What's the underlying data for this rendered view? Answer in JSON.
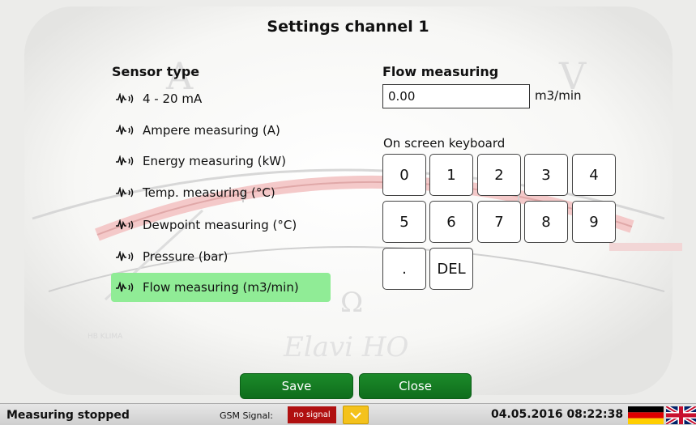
{
  "window": {
    "title": "Settings channel 1"
  },
  "sensor_panel": {
    "heading": "Sensor type",
    "items": [
      {
        "label": "4 - 20 mA",
        "selected": false
      },
      {
        "label": "Ampere measuring (A)",
        "selected": false
      },
      {
        "label": "Energy measuring (kW)",
        "selected": false
      },
      {
        "label": "Temp. measuring (°C)",
        "selected": false
      },
      {
        "label": "Dewpoint measuring (°C)",
        "selected": false
      },
      {
        "label": "Pressure (bar)",
        "selected": false
      },
      {
        "label": "Flow measuring (m3/min)",
        "selected": true
      }
    ],
    "item_icon": "sensor-signal-icon",
    "selected_color": "#90ec96"
  },
  "flow_panel": {
    "heading": "Flow measuring",
    "value": "0.00",
    "unit": "m3/min"
  },
  "keyboard": {
    "label": "On screen keyboard",
    "keys": [
      "0",
      "1",
      "2",
      "3",
      "4",
      "5",
      "6",
      "7",
      "8",
      "9",
      ".",
      "DEL"
    ]
  },
  "actions": {
    "save_label": "Save",
    "close_label": "Close",
    "button_color": "#147d24"
  },
  "background": {
    "meter_brand": "Elavi HO",
    "meter_symbol": "Ω",
    "meter_letters": [
      "A",
      "V"
    ],
    "meter_tag": "HB KLIMA"
  },
  "status_bar": {
    "measuring_status": "Measuring stopped",
    "gsm_label": "GSM Signal:",
    "gsm_status": "no signal",
    "gsm_status_color": "#b01010",
    "warning_icon": "chevron-down-icon",
    "warning_color": "#f4c21c",
    "datetime": "04.05.2016 08:22:38",
    "languages": [
      "german-flag-icon",
      "uk-flag-icon"
    ]
  }
}
